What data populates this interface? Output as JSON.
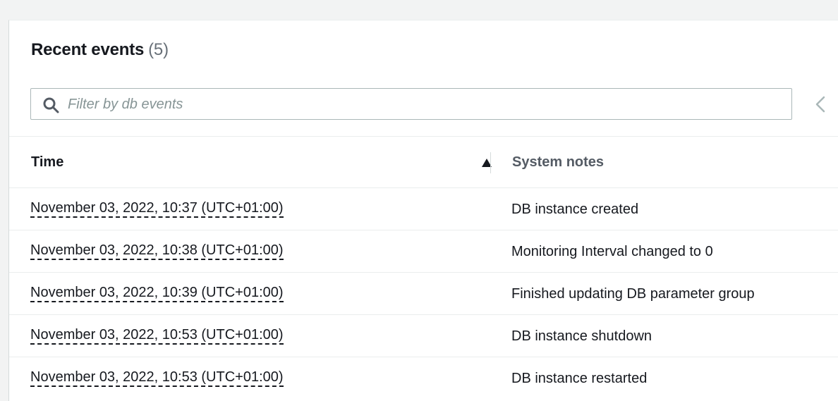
{
  "events_panel": {
    "title": "Recent events",
    "count": "(5)",
    "filter": {
      "placeholder": "Filter by db events",
      "value": ""
    },
    "columns": {
      "time": "Time",
      "notes": "System notes"
    },
    "rows": [
      {
        "time": "November 03, 2022, 10:37 (UTC+01:00)",
        "note": "DB instance created"
      },
      {
        "time": "November 03, 2022, 10:38 (UTC+01:00)",
        "note": "Monitoring Interval changed to 0"
      },
      {
        "time": "November 03, 2022, 10:39 (UTC+01:00)",
        "note": "Finished updating DB parameter group"
      },
      {
        "time": "November 03, 2022, 10:53 (UTC+01:00)",
        "note": "DB instance shutdown"
      },
      {
        "time": "November 03, 2022, 10:53 (UTC+01:00)",
        "note": "DB instance restarted"
      }
    ],
    "icons": {
      "search": "search-icon",
      "sort": "sort-ascending-icon",
      "prev_page": "chevron-left-icon"
    }
  }
}
